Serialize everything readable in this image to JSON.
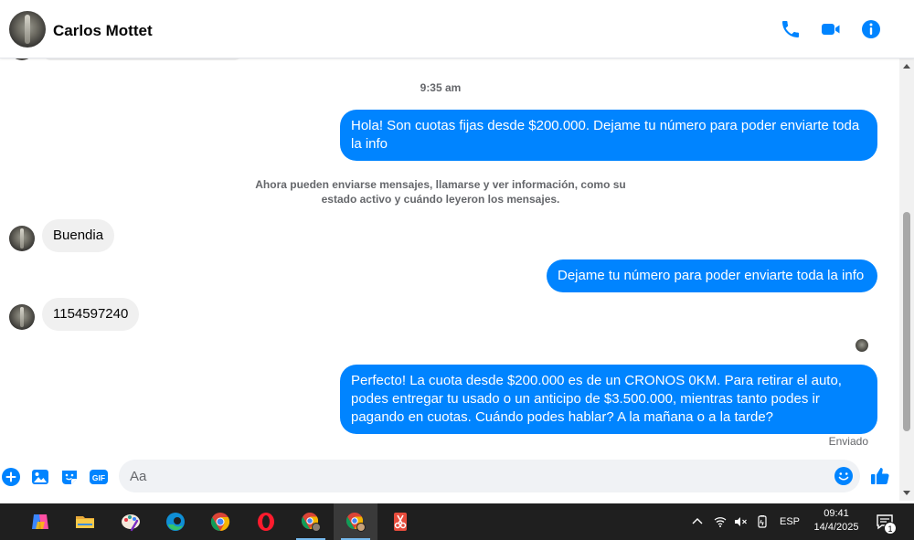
{
  "header": {
    "contact_name": "Carlos Mottet",
    "icons": [
      "phone-icon",
      "video-call-icon",
      "info-icon"
    ],
    "accent_color": "#0084ff"
  },
  "chat": {
    "timestamp": "9:35 am",
    "notice": "Ahora pueden enviarse mensajes, llamarse y ver información, como su estado activo y cuándo leyeron los mensajes.",
    "messages": [
      {
        "direction": "outgoing",
        "text": "Hola! Son cuotas fijas desde $200.000. Dejame tu número para poder enviarte toda la info"
      },
      {
        "direction": "incoming",
        "text": "Buendia"
      },
      {
        "direction": "outgoing",
        "text": "Dejame tu número para poder enviarte toda la info"
      },
      {
        "direction": "incoming",
        "text": "1154597240"
      },
      {
        "direction": "outgoing",
        "text": "Perfecto! La cuota desde $200.000 es de un CRONOS 0KM. Para retirar el auto, podes entregar tu usado o un anticipo de $3.500.000, mientras tanto podes ir pagando en cuotas. Cuándo podes hablar? A la mañana o a la tarde?"
      }
    ],
    "status": "Enviado"
  },
  "composer": {
    "placeholder": "Aa",
    "actions": [
      "plus-icon",
      "gallery-icon",
      "sticker-icon",
      "gif-icon"
    ],
    "gif_label": "GIF"
  },
  "taskbar": {
    "apps": [
      "copilot-icon",
      "file-explorer-icon",
      "paint-icon",
      "edge-icon",
      "chrome-icon",
      "opera-icon",
      "chrome-profile-icon",
      "chrome-profile-active-icon",
      "snipping-tool-icon"
    ],
    "language": "ESP",
    "time": "09:41",
    "date": "14/4/2025",
    "notification_count": "1"
  }
}
